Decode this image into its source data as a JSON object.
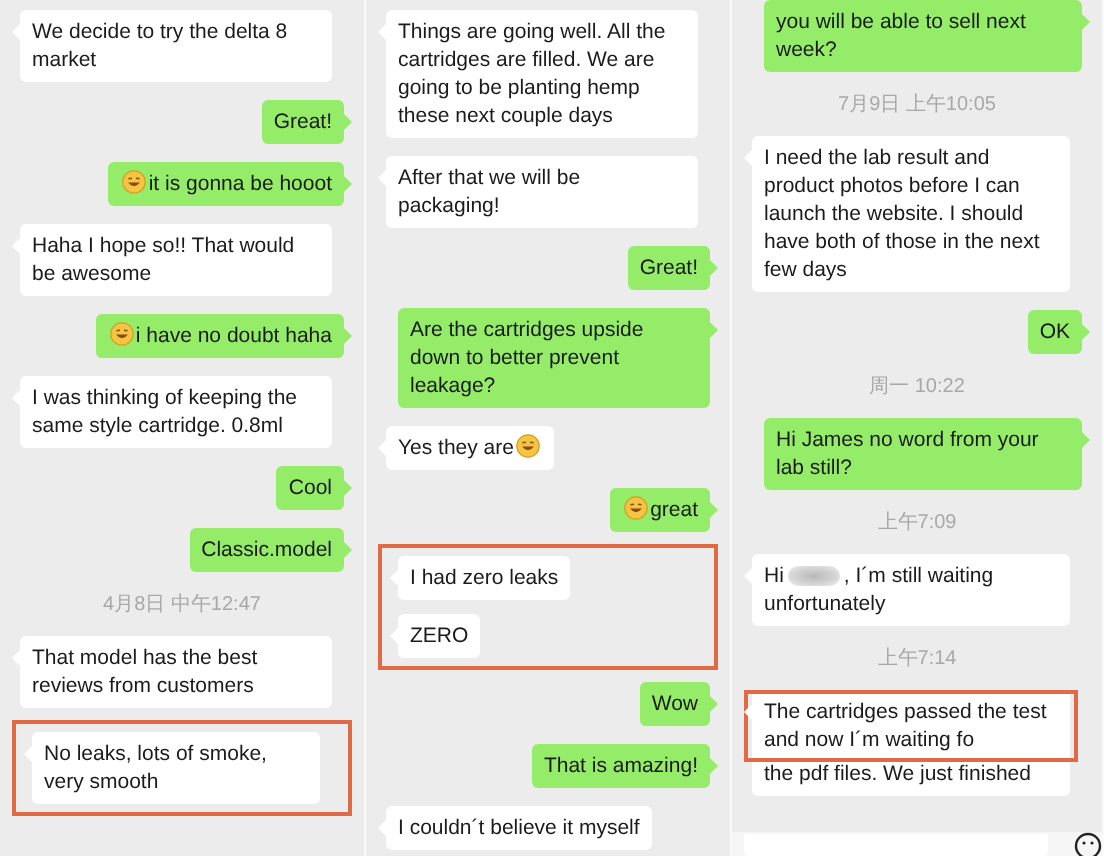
{
  "columns": [
    {
      "messages": [
        {
          "kind": "received",
          "text": "We decide to try the delta 8 market"
        },
        {
          "kind": "sent",
          "text": "Great!"
        },
        {
          "kind": "sent",
          "text": "it is gonna be hooot",
          "emoji_leading": true
        },
        {
          "kind": "received",
          "text": "Haha I hope so!! That would be awesome"
        },
        {
          "kind": "sent",
          "text": "i have no doubt haha",
          "emoji_leading": true
        },
        {
          "kind": "received",
          "text": "I was thinking of keeping the same style cartridge. 0.8ml"
        },
        {
          "kind": "sent",
          "text": "Cool"
        },
        {
          "kind": "sent",
          "text": "Classic.model"
        },
        {
          "kind": "time",
          "text": "4月8日 中午12:47"
        },
        {
          "kind": "received",
          "text": "That model has the best reviews from customers"
        },
        {
          "kind": "highlight",
          "messages": [
            {
              "kind": "received",
              "text": "No leaks, lots of smoke, very smooth"
            }
          ]
        }
      ]
    },
    {
      "messages": [
        {
          "kind": "received",
          "text": "Things are going well. All the cartridges are filled. We are going to be planting hemp these next couple days"
        },
        {
          "kind": "received",
          "text": "After that we will be packaging!"
        },
        {
          "kind": "sent",
          "text": "Great!"
        },
        {
          "kind": "sent",
          "text": "Are the cartridges upside down to better prevent leakage?"
        },
        {
          "kind": "received",
          "text": "Yes they are",
          "emoji_trailing": true
        },
        {
          "kind": "sent",
          "text": "great",
          "emoji_leading": true
        },
        {
          "kind": "highlight",
          "messages": [
            {
              "kind": "received",
              "text": "I had zero leaks"
            },
            {
              "kind": "received",
              "text": "ZERO"
            }
          ]
        },
        {
          "kind": "sent",
          "text": "Wow"
        },
        {
          "kind": "sent",
          "text": "That is amazing!"
        },
        {
          "kind": "received",
          "text": "I couldn´t believe it myself"
        }
      ]
    },
    {
      "messages": [
        {
          "kind": "sent",
          "text": "you will be able to sell next week?"
        },
        {
          "kind": "time",
          "text": "7月9日 上午10:05"
        },
        {
          "kind": "received",
          "text": "I need the lab result and product photos before I can launch the website. I should have both of those in the next few days"
        },
        {
          "kind": "sent",
          "text": "OK"
        },
        {
          "kind": "time",
          "text": "周一 10:22"
        },
        {
          "kind": "sent",
          "text": "Hi James no word from your lab still?"
        },
        {
          "kind": "time",
          "text": "上午7:09"
        },
        {
          "kind": "received",
          "segments": [
            {
              "kind": "text",
              "text": "Hi"
            },
            {
              "kind": "redacted"
            },
            {
              "kind": "text",
              "text": ", I´m still waiting unfortunately"
            }
          ]
        },
        {
          "kind": "time",
          "text": "上午7:14"
        },
        {
          "kind": "received",
          "segments": [
            {
              "kind": "text",
              "text": "The cartridges passed the test and now I´m waiting fo",
              "highlighted": true
            },
            {
              "kind": "text",
              "text": "the pdf files. We just finished"
            }
          ]
        }
      ],
      "input_bar": true
    }
  ]
}
